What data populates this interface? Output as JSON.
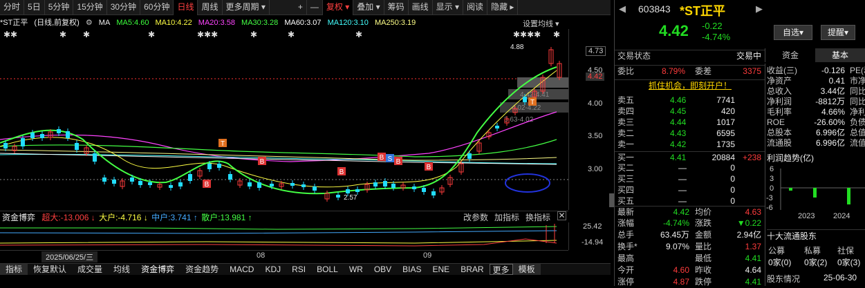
{
  "toolbar": {
    "periods": [
      "分时",
      "5日",
      "5分钟",
      "15分钟",
      "30分钟",
      "60分钟",
      "日线",
      "周线",
      "更多周期"
    ],
    "active": "日线",
    "buttons": [
      "+",
      "—",
      "复权",
      "叠加",
      "筹码",
      "画线",
      "显示",
      "阅读",
      "隐藏"
    ]
  },
  "chart": {
    "title": "*ST正平",
    "subtitle": "(日线,前复权)",
    "ma_label": "MA",
    "ma": [
      {
        "label": "MA5:4.60",
        "color": "#3cff3c"
      },
      {
        "label": "MA10:4.22",
        "color": "#ffff44"
      },
      {
        "label": "MA20:3.58",
        "color": "#ff44ff"
      },
      {
        "label": "MA30:3.28",
        "color": "#44ff44"
      },
      {
        "label": "MA60:3.07",
        "color": "#ffffff"
      },
      {
        "label": "MA120:3.10",
        "color": "#44ffff"
      },
      {
        "label": "MA250:3.19",
        "color": "#ffff88"
      }
    ],
    "settings": "设置均线",
    "y_ticks": [
      "4.73",
      "4.50",
      "4.42",
      "4.00",
      "3.50",
      "3.00"
    ],
    "high_label": "4.88",
    "low_label": "2.57",
    "chip_labels": [
      "4.42-4.41",
      "4.02-4.22",
      "3.63-4.02"
    ],
    "markers": [
      "T",
      "B",
      "B",
      "B",
      "B",
      "S",
      "B",
      "B",
      "T"
    ]
  },
  "fund": {
    "title": "资金博弈",
    "items": [
      {
        "label": "超大:-13.006",
        "color": "#ff4040"
      },
      {
        "label": "大户:-4.716",
        "color": "#ffff44"
      },
      {
        "label": "中户:3.741",
        "color": "#44aaff"
      },
      {
        "label": "散户:13.981",
        "color": "#44ff44"
      }
    ],
    "tools": [
      "改参数",
      "加指标",
      "换指标"
    ],
    "y_ticks": [
      "25.42",
      "-14.94"
    ]
  },
  "x_axis": {
    "date": "2025/06/25/三",
    "months": [
      "08",
      "09"
    ]
  },
  "bottom_tabs": [
    "指标",
    "恢复默认",
    "成交量",
    "均线",
    "资金博弈",
    "资金趋势",
    "MACD",
    "KDJ",
    "RSI",
    "BOLL",
    "WR",
    "OBV",
    "BIAS",
    "ENE",
    "BRAR",
    "更多",
    "模板"
  ],
  "quote": {
    "code": "603843",
    "name": "*ST正平",
    "price": "4.42",
    "change": "-0.22",
    "pct": "-4.74%",
    "btn_fav": "自选",
    "btn_alert": "提醒",
    "status_label": "交易状态",
    "status": "交易中",
    "weibi_label": "委比",
    "weibi": "8.79%",
    "weicha_label": "委差",
    "weicha": "3375",
    "banner": "抓住机会，即刻开户！"
  },
  "asks": [
    {
      "n": "卖五",
      "p": "4.46",
      "v": "7741"
    },
    {
      "n": "卖四",
      "p": "4.45",
      "v": "420"
    },
    {
      "n": "卖三",
      "p": "4.44",
      "v": "1017"
    },
    {
      "n": "卖二",
      "p": "4.43",
      "v": "6595"
    },
    {
      "n": "卖一",
      "p": "4.42",
      "v": "1735"
    }
  ],
  "bids": [
    {
      "n": "买一",
      "p": "4.41",
      "v": "20884",
      "d": "+238"
    },
    {
      "n": "买二",
      "p": "—",
      "v": "0",
      "d": ""
    },
    {
      "n": "买三",
      "p": "—",
      "v": "0",
      "d": ""
    },
    {
      "n": "买四",
      "p": "—",
      "v": "0",
      "d": ""
    },
    {
      "n": "买五",
      "p": "—",
      "v": "0",
      "d": ""
    }
  ],
  "stats": [
    {
      "l": "最新",
      "v": "4.42",
      "c": "grn",
      "l2": "均价",
      "v2": "4.63",
      "c2": "red"
    },
    {
      "l": "涨幅",
      "v": "-4.74%",
      "c": "grn",
      "l2": "涨跌",
      "v2": "▼0.22",
      "c2": "grn"
    },
    {
      "l": "总手",
      "v": "63.45万",
      "c": "wht",
      "l2": "金额",
      "v2": "2.94亿",
      "c2": "wht"
    },
    {
      "l": "换手*",
      "v": "9.07%",
      "c": "wht",
      "l2": "量比",
      "v2": "1.37",
      "c2": "red"
    },
    {
      "l": "最高",
      "v": "",
      "c": "red",
      "l2": "最低",
      "v2": "4.41",
      "c2": "grn"
    },
    {
      "l": "今开",
      "v": "4.60",
      "c": "red",
      "l2": "昨收",
      "v2": "4.64",
      "c2": "wht"
    },
    {
      "l": "涨停",
      "v": "4.87",
      "c": "red",
      "l2": "跌停",
      "v2": "4.41",
      "c2": "grn"
    }
  ],
  "fin": {
    "tabs": [
      "资金",
      "基本"
    ],
    "rows": [
      [
        "收益(三)",
        "-0.126",
        "PE(动)"
      ],
      [
        "净资产",
        "0.41",
        "市净率"
      ],
      [
        "总收入",
        "3.44亿",
        "同比"
      ],
      [
        "净利润",
        "-8812万",
        "同比"
      ],
      [
        "毛利率",
        "4.66%",
        "净利率"
      ],
      [
        "ROE",
        "-26.60%",
        "负债率"
      ],
      [
        "总股本",
        "6.996亿",
        "总值"
      ],
      [
        "流通股",
        "6.996亿",
        "流值"
      ]
    ],
    "trend_title": "利润趋势(亿)",
    "trend_ticks": [
      "6",
      "3",
      "0",
      "-3",
      "-6"
    ],
    "years": [
      "2023",
      "2024"
    ],
    "holders": "十大流通股东",
    "cats": [
      "公募",
      "私募",
      "社保"
    ],
    "counts": [
      "0家(0)",
      "0家(2)",
      "0家(3)"
    ],
    "holder_label": "股东情况",
    "holder_date": "25-06-30"
  }
}
